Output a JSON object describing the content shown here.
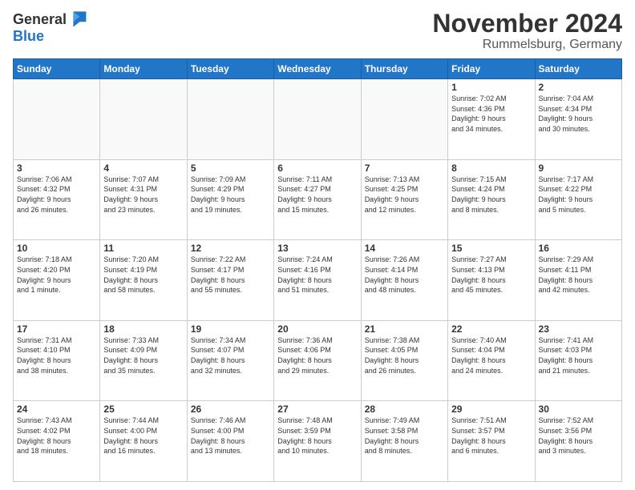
{
  "header": {
    "logo_general": "General",
    "logo_blue": "Blue",
    "month": "November 2024",
    "location": "Rummelsburg, Germany"
  },
  "weekdays": [
    "Sunday",
    "Monday",
    "Tuesday",
    "Wednesday",
    "Thursday",
    "Friday",
    "Saturday"
  ],
  "weeks": [
    [
      {
        "day": "",
        "info": ""
      },
      {
        "day": "",
        "info": ""
      },
      {
        "day": "",
        "info": ""
      },
      {
        "day": "",
        "info": ""
      },
      {
        "day": "",
        "info": ""
      },
      {
        "day": "1",
        "info": "Sunrise: 7:02 AM\nSunset: 4:36 PM\nDaylight: 9 hours\nand 34 minutes."
      },
      {
        "day": "2",
        "info": "Sunrise: 7:04 AM\nSunset: 4:34 PM\nDaylight: 9 hours\nand 30 minutes."
      }
    ],
    [
      {
        "day": "3",
        "info": "Sunrise: 7:06 AM\nSunset: 4:32 PM\nDaylight: 9 hours\nand 26 minutes."
      },
      {
        "day": "4",
        "info": "Sunrise: 7:07 AM\nSunset: 4:31 PM\nDaylight: 9 hours\nand 23 minutes."
      },
      {
        "day": "5",
        "info": "Sunrise: 7:09 AM\nSunset: 4:29 PM\nDaylight: 9 hours\nand 19 minutes."
      },
      {
        "day": "6",
        "info": "Sunrise: 7:11 AM\nSunset: 4:27 PM\nDaylight: 9 hours\nand 15 minutes."
      },
      {
        "day": "7",
        "info": "Sunrise: 7:13 AM\nSunset: 4:25 PM\nDaylight: 9 hours\nand 12 minutes."
      },
      {
        "day": "8",
        "info": "Sunrise: 7:15 AM\nSunset: 4:24 PM\nDaylight: 9 hours\nand 8 minutes."
      },
      {
        "day": "9",
        "info": "Sunrise: 7:17 AM\nSunset: 4:22 PM\nDaylight: 9 hours\nand 5 minutes."
      }
    ],
    [
      {
        "day": "10",
        "info": "Sunrise: 7:18 AM\nSunset: 4:20 PM\nDaylight: 9 hours\nand 1 minute."
      },
      {
        "day": "11",
        "info": "Sunrise: 7:20 AM\nSunset: 4:19 PM\nDaylight: 8 hours\nand 58 minutes."
      },
      {
        "day": "12",
        "info": "Sunrise: 7:22 AM\nSunset: 4:17 PM\nDaylight: 8 hours\nand 55 minutes."
      },
      {
        "day": "13",
        "info": "Sunrise: 7:24 AM\nSunset: 4:16 PM\nDaylight: 8 hours\nand 51 minutes."
      },
      {
        "day": "14",
        "info": "Sunrise: 7:26 AM\nSunset: 4:14 PM\nDaylight: 8 hours\nand 48 minutes."
      },
      {
        "day": "15",
        "info": "Sunrise: 7:27 AM\nSunset: 4:13 PM\nDaylight: 8 hours\nand 45 minutes."
      },
      {
        "day": "16",
        "info": "Sunrise: 7:29 AM\nSunset: 4:11 PM\nDaylight: 8 hours\nand 42 minutes."
      }
    ],
    [
      {
        "day": "17",
        "info": "Sunrise: 7:31 AM\nSunset: 4:10 PM\nDaylight: 8 hours\nand 38 minutes."
      },
      {
        "day": "18",
        "info": "Sunrise: 7:33 AM\nSunset: 4:09 PM\nDaylight: 8 hours\nand 35 minutes."
      },
      {
        "day": "19",
        "info": "Sunrise: 7:34 AM\nSunset: 4:07 PM\nDaylight: 8 hours\nand 32 minutes."
      },
      {
        "day": "20",
        "info": "Sunrise: 7:36 AM\nSunset: 4:06 PM\nDaylight: 8 hours\nand 29 minutes."
      },
      {
        "day": "21",
        "info": "Sunrise: 7:38 AM\nSunset: 4:05 PM\nDaylight: 8 hours\nand 26 minutes."
      },
      {
        "day": "22",
        "info": "Sunrise: 7:40 AM\nSunset: 4:04 PM\nDaylight: 8 hours\nand 24 minutes."
      },
      {
        "day": "23",
        "info": "Sunrise: 7:41 AM\nSunset: 4:03 PM\nDaylight: 8 hours\nand 21 minutes."
      }
    ],
    [
      {
        "day": "24",
        "info": "Sunrise: 7:43 AM\nSunset: 4:02 PM\nDaylight: 8 hours\nand 18 minutes."
      },
      {
        "day": "25",
        "info": "Sunrise: 7:44 AM\nSunset: 4:00 PM\nDaylight: 8 hours\nand 16 minutes."
      },
      {
        "day": "26",
        "info": "Sunrise: 7:46 AM\nSunset: 4:00 PM\nDaylight: 8 hours\nand 13 minutes."
      },
      {
        "day": "27",
        "info": "Sunrise: 7:48 AM\nSunset: 3:59 PM\nDaylight: 8 hours\nand 10 minutes."
      },
      {
        "day": "28",
        "info": "Sunrise: 7:49 AM\nSunset: 3:58 PM\nDaylight: 8 hours\nand 8 minutes."
      },
      {
        "day": "29",
        "info": "Sunrise: 7:51 AM\nSunset: 3:57 PM\nDaylight: 8 hours\nand 6 minutes."
      },
      {
        "day": "30",
        "info": "Sunrise: 7:52 AM\nSunset: 3:56 PM\nDaylight: 8 hours\nand 3 minutes."
      }
    ]
  ]
}
